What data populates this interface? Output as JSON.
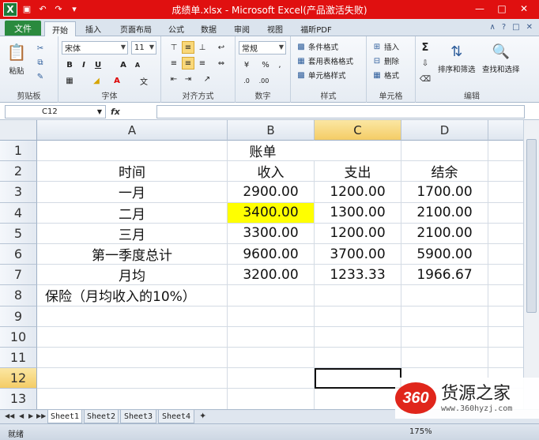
{
  "window": {
    "title": "成绩单.xlsx - Microsoft Excel(产品激活失败)"
  },
  "ribbon": {
    "file_tab": "文件",
    "tabs": [
      "开始",
      "插入",
      "页面布局",
      "公式",
      "数据",
      "审阅",
      "视图",
      "福昕PDF"
    ],
    "active_tab": "开始",
    "clipboard": {
      "label": "剪贴板",
      "paste": "粘贴"
    },
    "font": {
      "label": "字体",
      "name": "宋体",
      "size": "11"
    },
    "alignment": {
      "label": "对齐方式"
    },
    "number": {
      "label": "数字",
      "format": "常规"
    },
    "styles": {
      "label": "样式",
      "conditional": "条件格式",
      "table": "套用表格格式",
      "cell_styles": "单元格样式"
    },
    "cells": {
      "label": "单元格",
      "insert": "插入",
      "delete": "删除",
      "format": "格式"
    },
    "editing": {
      "label": "编辑",
      "sort": "排序和筛选",
      "find": "查找和选择"
    }
  },
  "formula_bar": {
    "name_box": "C12",
    "fx": "fx",
    "value": ""
  },
  "sheet": {
    "columns": [
      "A",
      "B",
      "C",
      "D"
    ],
    "selected_column": "C",
    "selected_row": "12",
    "rows": [
      {
        "num": "1",
        "cells": [
          "",
          "账单",
          "",
          ""
        ]
      },
      {
        "num": "2",
        "cells": [
          "时间",
          "收入",
          "支出",
          "结余"
        ]
      },
      {
        "num": "3",
        "cells": [
          "一月",
          "2900.00",
          "1200.00",
          "1700.00"
        ]
      },
      {
        "num": "4",
        "cells": [
          "二月",
          "3400.00",
          "1300.00",
          "2100.00"
        ]
      },
      {
        "num": "5",
        "cells": [
          "三月",
          "3300.00",
          "1200.00",
          "2100.00"
        ]
      },
      {
        "num": "6",
        "cells": [
          "第一季度总计",
          "9600.00",
          "3700.00",
          "5900.00"
        ]
      },
      {
        "num": "7",
        "cells": [
          "月均",
          "3200.00",
          "1233.33",
          "1966.67"
        ]
      },
      {
        "num": "8",
        "cells": [
          "保险（月均收入的10%）",
          "",
          "",
          ""
        ]
      },
      {
        "num": "9",
        "cells": [
          "",
          "",
          "",
          ""
        ]
      },
      {
        "num": "10",
        "cells": [
          "",
          "",
          "",
          ""
        ]
      },
      {
        "num": "11",
        "cells": [
          "",
          "",
          "",
          ""
        ]
      },
      {
        "num": "12",
        "cells": [
          "",
          "",
          "",
          ""
        ]
      },
      {
        "num": "13",
        "cells": [
          "",
          "",
          "",
          ""
        ]
      }
    ],
    "highlight_color": "#ffff00"
  },
  "sheet_tabs": [
    "Sheet1",
    "Sheet2",
    "Sheet3",
    "Sheet4"
  ],
  "active_sheet": "Sheet1",
  "status": {
    "text": "就绪",
    "zoom": "175%"
  },
  "watermark": {
    "logo": "360",
    "title": "货源之家",
    "url": "www.360hyzj.com"
  },
  "colors": {
    "title_bar": "#e01010",
    "file_tab": "#2a8a3e",
    "selected_header": "#f4cc66"
  }
}
